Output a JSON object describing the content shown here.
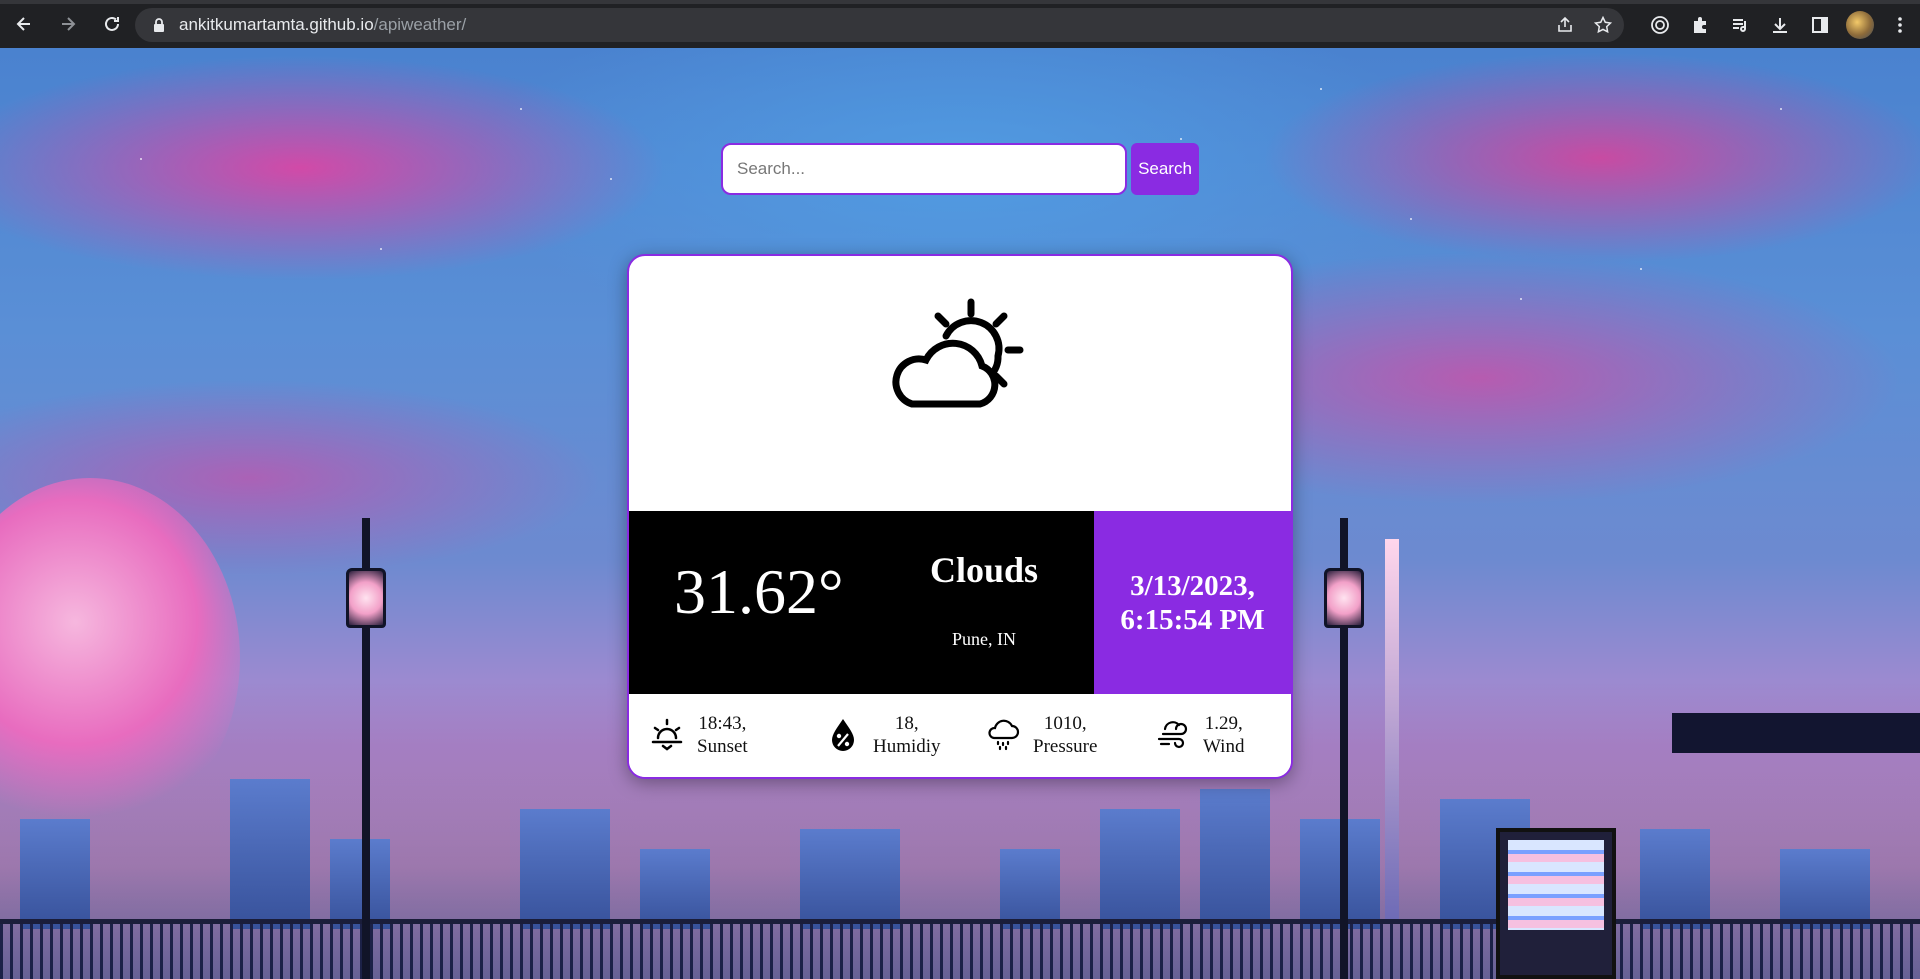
{
  "browser": {
    "url_host": "ankitkumartamta.github.io",
    "url_path": "/apiweather/"
  },
  "search": {
    "placeholder": "Search...",
    "value": "",
    "button_label": "Search"
  },
  "weather": {
    "icon": "partly-cloudy-icon",
    "temperature": "31.62°",
    "condition": "Clouds",
    "location": "Pune, IN",
    "date": "3/13/2023,",
    "time": "6:15:54 PM",
    "stats": [
      {
        "icon": "sunset-icon",
        "value": "18:43,",
        "label": "Sunset"
      },
      {
        "icon": "humidity-icon",
        "value": "18,",
        "label": "Humidiy"
      },
      {
        "icon": "pressure-icon",
        "value": "1010,",
        "label": "Pressure"
      },
      {
        "icon": "wind-icon",
        "value": "1.29,",
        "label": "Wind"
      }
    ]
  },
  "colors": {
    "accent": "#8a2be2",
    "panel_dark": "#000000",
    "card_bg": "#ffffff"
  }
}
